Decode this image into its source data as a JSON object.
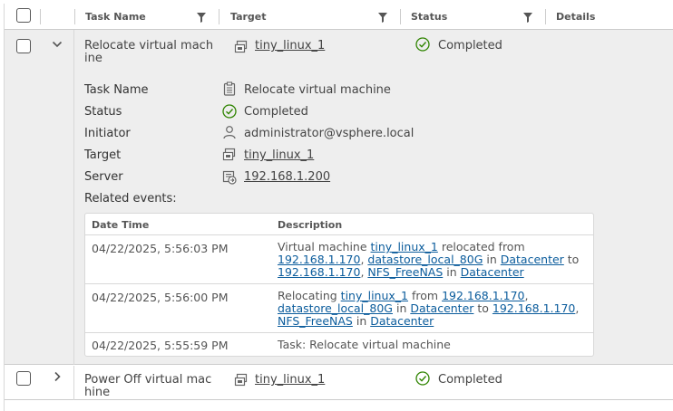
{
  "columns": {
    "task_name": "Task Name",
    "target": "Target",
    "status": "Status",
    "details": "Details"
  },
  "rows": [
    {
      "task_name_line1": "Relocate virtual mach",
      "task_name_line2": "ine",
      "target": "tiny_linux_1",
      "status": "Completed",
      "expanded": true
    },
    {
      "task_name_line1": "Power Off virtual mac",
      "task_name_line2": "hine",
      "target": "tiny_linux_1",
      "status": "Completed",
      "expanded": false
    }
  ],
  "details": {
    "task_name_label": "Task Name",
    "task_name_value": "Relocate virtual machine",
    "status_label": "Status",
    "status_value": "Completed",
    "initiator_label": "Initiator",
    "initiator_value": "administrator@vsphere.local",
    "target_label": "Target",
    "target_value": "tiny_linux_1",
    "server_label": "Server",
    "server_value": "192.168.1.200",
    "related_events_label": "Related events:"
  },
  "events": {
    "col_datetime": "Date Time",
    "col_description": "Description",
    "rows": [
      {
        "datetime": "04/22/2025, 5:56:03 PM",
        "parts": {
          "t1": "Virtual machine ",
          "vm": "tiny_linux_1",
          "t2": " relocated from ",
          "host1": "192.168.1.170",
          "t3": ", ",
          "ds1": "datastore_local_80G",
          "t4": " in ",
          "dc1": "Datacenter",
          "t5": " to ",
          "host2": "192.168.1.170",
          "t6": ", ",
          "ds2": "NFS_FreeNAS",
          "t7": " in ",
          "dc2": "Datacenter"
        }
      },
      {
        "datetime": "04/22/2025, 5:56:00 PM",
        "parts": {
          "t1": "Relocating ",
          "vm": "tiny_linux_1",
          "t2": " from ",
          "host1": "192.168.1.170",
          "t3": ", ",
          "ds1": "datastore_local_80G",
          "t4": " in ",
          "dc1": "Datacenter",
          "t5": " to ",
          "host2": "192.168.1.170",
          "t6": ", ",
          "ds2": "NFS_FreeNAS",
          "t7": " in ",
          "dc2": "Datacenter"
        }
      },
      {
        "datetime": "04/22/2025, 5:55:59 PM",
        "description": "Task: Relocate virtual machine"
      }
    ]
  },
  "colors": {
    "link": "#0b5c9c",
    "success": "#2f8400",
    "row_selected_bg": "#eeeeee"
  },
  "icons": {
    "filter": "filter-icon",
    "vm": "vm-icon",
    "status_ok": "check-circle-icon",
    "user": "user-icon",
    "clipboard": "clipboard-icon",
    "server": "vcenter-server-icon",
    "expand": "chevron-icon"
  }
}
